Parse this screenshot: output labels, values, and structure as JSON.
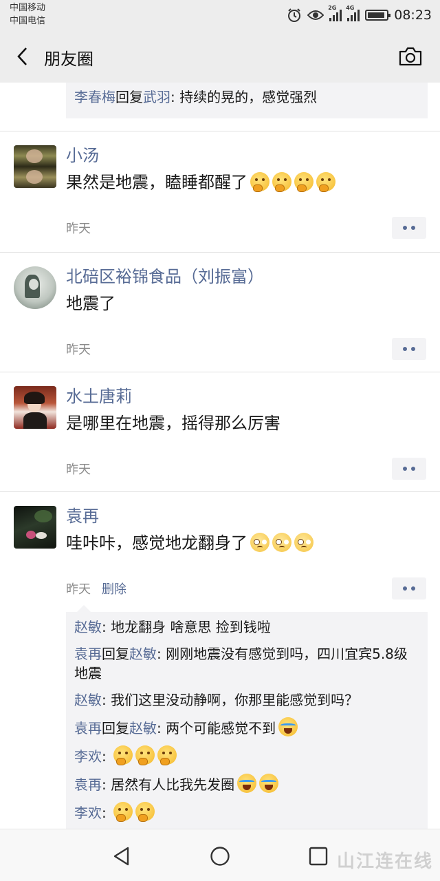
{
  "status_bar": {
    "carrier1": "中国移动",
    "carrier2": "中国电信",
    "net1": "2G",
    "net2": "4G",
    "time": "08:23",
    "battery_level": 0.9,
    "icons": [
      "alarm-icon",
      "eye-icon",
      "signal-icon",
      "battery-icon"
    ]
  },
  "nav": {
    "title": "朋友圈",
    "back_icon": "chevron-left-icon",
    "camera_icon": "camera-icon"
  },
  "top_comment": {
    "from": "李春梅",
    "reply_word": "回复",
    "to": "武羽",
    "text": ": 持续的晃的，感觉强烈"
  },
  "posts": [
    {
      "name": "小汤",
      "text": "果然是地震，瞌睡都醒了",
      "emoji": "thinking-face",
      "emoji_count": 4,
      "time": "昨天"
    },
    {
      "name": "北碚区裕锦食品（刘振富）",
      "text": "地震了",
      "time": "昨天"
    },
    {
      "name": "水土唐莉",
      "text": "是哪里在地震，摇得那么厉害",
      "time": "昨天"
    },
    {
      "name": "袁再",
      "text": "哇咔咔，感觉地龙翻身了",
      "emoji": "worried-face",
      "emoji_count": 3,
      "time": "昨天",
      "delete_label": "删除",
      "comments": [
        {
          "from": "赵敏",
          "text": ": 地龙翻身  啥意思 捡到钱啦"
        },
        {
          "from": "袁再",
          "reply_word": "回复",
          "to": "赵敏",
          "text": ": 刚刚地震没有感觉到吗，四川宜宾5.8级地震"
        },
        {
          "from": "赵敏",
          "text": ": 我们这里没动静啊，你那里能感觉到吗？"
        },
        {
          "from": "袁再",
          "reply_word": "回复",
          "to": "赵敏",
          "text": ": 两个可能感觉不到",
          "emoji": "crying-face",
          "emoji_count": 1
        },
        {
          "from": "李欢",
          "text": ": ",
          "emoji": "thinking-face",
          "emoji_count": 3
        },
        {
          "from": "袁再",
          "text": ": 居然有人比我先发圈",
          "emoji": "crying-face",
          "emoji_count": 2
        },
        {
          "from": "李欢",
          "text": ": ",
          "emoji": "thinking-face",
          "emoji_count": 2
        }
      ]
    }
  ],
  "bottom_nav": {
    "icons": [
      "back-triangle-icon",
      "home-circle-icon",
      "recents-square-icon"
    ],
    "watermark": "山江连在线"
  },
  "colors": {
    "name_blue": "#576b95",
    "bar_gray": "#ededed",
    "comment_bg": "#f3f3f5"
  }
}
